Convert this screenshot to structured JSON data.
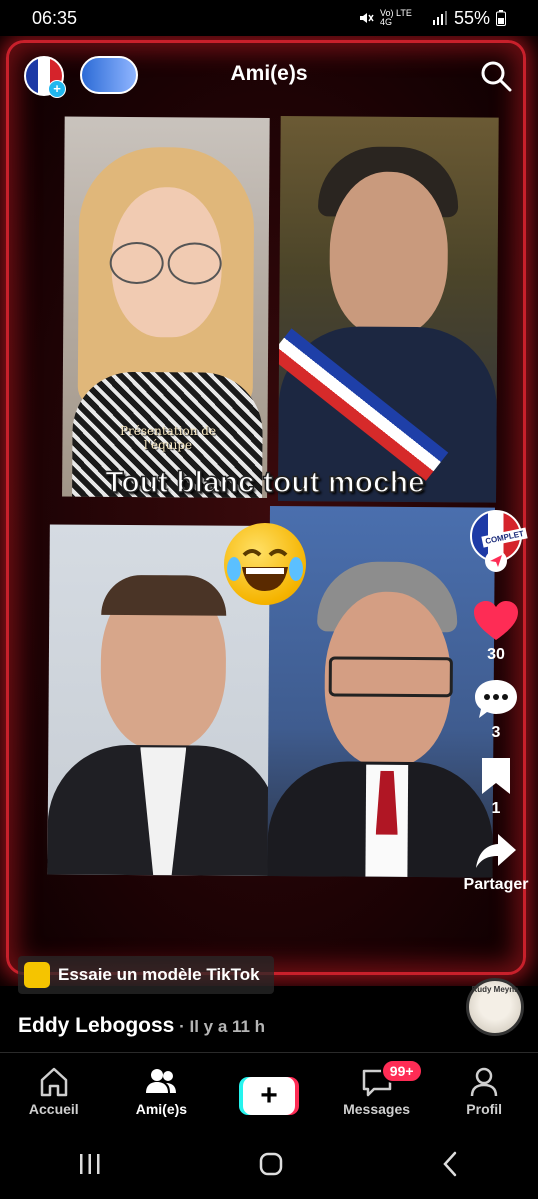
{
  "status_bar": {
    "time": "06:35",
    "network": "Vo) LTE 4G",
    "battery": "55%"
  },
  "top_bar": {
    "title": "Ami(e)s"
  },
  "video": {
    "overlay_text": "Tout blanc tout moche",
    "small_caption": "Présentation de l'équipe"
  },
  "creator_badge": "COMPLET",
  "actions": {
    "likes": "30",
    "comments": "3",
    "bookmarks": "1",
    "share_label": "Partager"
  },
  "template_prompt": "Essaie un modèle TikTok",
  "post": {
    "author": "Eddy Lebogoss",
    "time": " · Il y a 11 h"
  },
  "music_disc_text": "Rudy Meyns",
  "nav": {
    "home": "Accueil",
    "friends": "Ami(e)s",
    "messages": "Messages",
    "messages_badge": "99+",
    "profile": "Profil"
  },
  "colors": {
    "accent_red": "#fe2c55",
    "accent_cyan": "#25f4ee",
    "frame_red": "#c8202b"
  }
}
